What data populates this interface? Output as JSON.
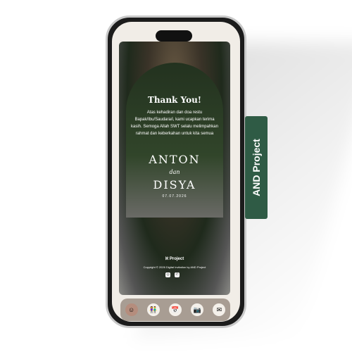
{
  "invitation": {
    "title": "Thank You!",
    "message": "Atas kehadiran dan doa restu Bapak/Ibu/Saudara/i, kami ucapkan terima kasih. Semoga Allah SWT selalu melimpahkan rahmat dan keberkahan untuk kita semua",
    "groom": "ANTON",
    "conjunction": "dan",
    "bride": "DISYA",
    "date": "07.07.2026",
    "brand": "Project",
    "copyright": "Copyright © 2026 Digital Invitation by AND Project"
  },
  "nav": [
    "couple-photo",
    "bride-groom",
    "calendar",
    "gallery",
    "gift"
  ],
  "side_tab": {
    "label": "AND Project",
    "color": "#2f5b45"
  }
}
